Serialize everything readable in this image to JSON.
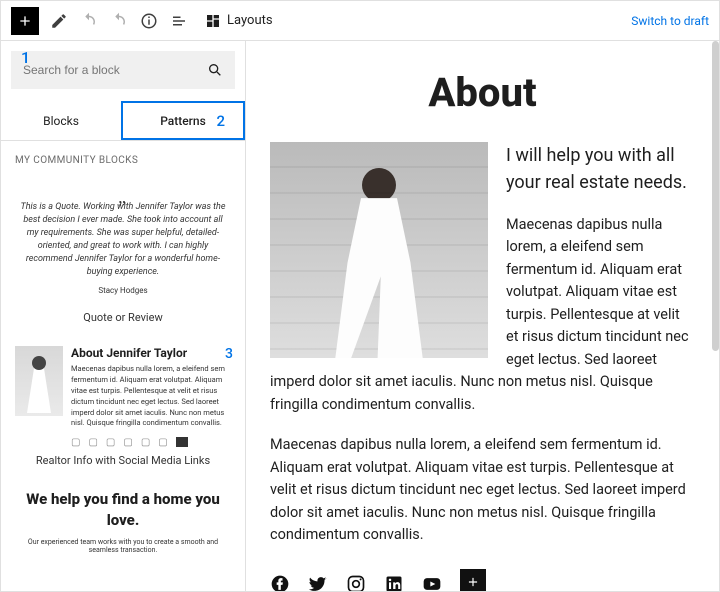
{
  "toolbar": {
    "layouts_label": "Layouts",
    "switch_draft": "Switch to draft"
  },
  "sidebar": {
    "badge1": "1",
    "search_placeholder": "Search for a block",
    "tabs": {
      "blocks": "Blocks",
      "patterns": "Patterns",
      "badge2": "2"
    },
    "section_title": "MY COMMUNITY BLOCKS",
    "quote": {
      "text": "This is a Quote. Working with Jennifer Taylor was the best decision I ever made. She took into account all my requirements. She was super helpful, detailed-oriented, and great to work with. I can highly recommend Jennifer Taylor for a wonderful home-buying experience.",
      "author": "Stacy Hodges",
      "label": "Quote or Review"
    },
    "realtor": {
      "heading": "About Jennifer Taylor",
      "badge3": "3",
      "body": "Maecenas dapibus nulla lorem, a eleifend sem fermentum id. Aliquam erat volutpat. Aliquam vitae est turpis. Pellentesque at velit et risus dictum tincidunt nec eget lectus. Sed laoreet imperd dolor sit amet iaculis. Nunc non metus nisl. Quisque fringilla condimentum convallis.",
      "label": "Realtor Info with Social Media Links"
    },
    "home": {
      "heading": "We help you find a home you love.",
      "sub": "Our experienced team works with you to create a smooth and seamless transaction."
    }
  },
  "editor": {
    "title": "About",
    "lead": "I will help you with all your real estate needs.",
    "para1": "Maecenas dapibus nulla lorem, a eleifend sem fermentum id. Aliquam erat volutpat. Aliquam vitae est turpis. Pellentesque at velit et risus dictum tincidunt nec eget lectus. Sed laoreet imperd dolor sit amet iaculis. Nunc non metus nisl. Quisque fringilla condimentum convallis.",
    "para2": "Maecenas dapibus nulla lorem, a eleifend sem fermentum id. Aliquam erat volutpat. Aliquam vitae est turpis. Pellentesque at velit et risus dictum tincidunt nec eget lectus. Sed laoreet imperd dolor sit amet iaculis. Nunc non metus nisl. Quisque fringilla condimentum convallis."
  }
}
